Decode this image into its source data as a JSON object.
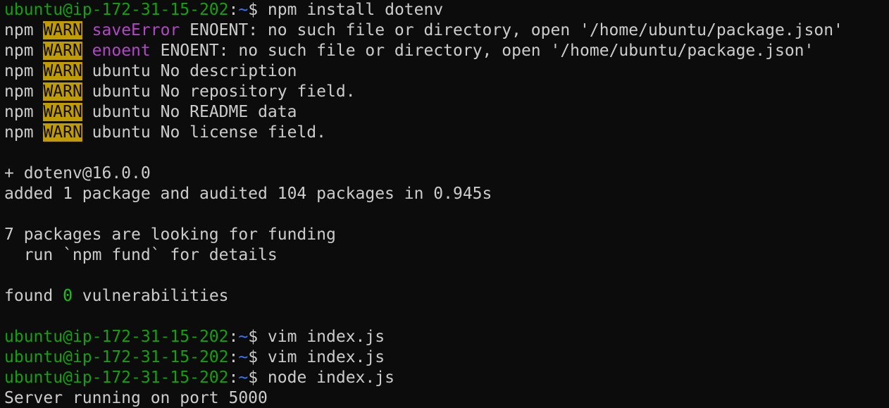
{
  "terminal": {
    "prompt_host": "ubuntu@ip-172-31-15-202",
    "prompt_sep": ":",
    "prompt_path": "~",
    "prompt_symbol": "$",
    "commands": {
      "cmd1": " npm install dotenv",
      "cmd2": " vim index.js",
      "cmd3": " vim index.js",
      "cmd4": " node index.js"
    },
    "npm": "npm",
    "warn": "WARN",
    "warn_lines": [
      {
        "tag": "saveError",
        "text": " ENOENT: no such file or directory, open '/home/ubuntu/package.json'"
      },
      {
        "tag": "enoent",
        "text": " ENOENT: no such file or directory, open '/home/ubuntu/package.json'"
      },
      {
        "tag": "ubuntu",
        "text": " No description"
      },
      {
        "tag": "ubuntu",
        "text": " No repository field."
      },
      {
        "tag": "ubuntu",
        "text": " No README data"
      },
      {
        "tag": "ubuntu",
        "text": " No license field."
      }
    ],
    "added_pkg": "+ dotenv@16.0.0",
    "added_summary": "added 1 package and audited 104 packages in 0.945s",
    "funding_line": "7 packages are looking for funding",
    "funding_hint": "  run `npm fund` for details",
    "found_prefix": "found ",
    "vuln_count": "0",
    "found_suffix": " vulnerabilities",
    "server_output": "Server running on port 5000"
  },
  "colors": {
    "background": "#0c0c0c",
    "text": "#cccccc",
    "prompt_user": "#13a10e",
    "prompt_path": "#3b78ff",
    "warn_bg": "#c19c00",
    "warn_tag_magenta": "#b148c6",
    "vuln_green": "#16c60c"
  }
}
